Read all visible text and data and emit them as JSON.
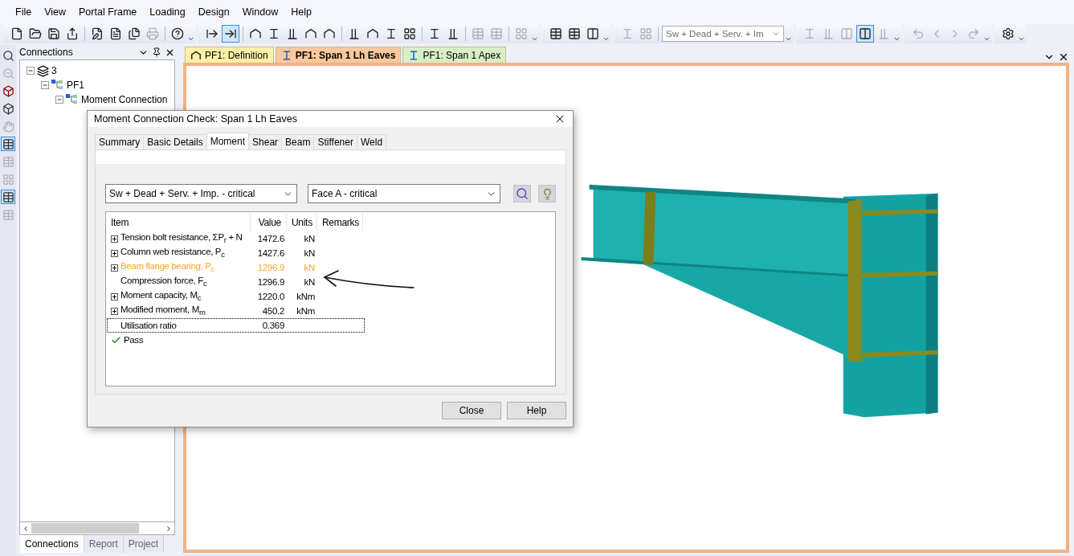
{
  "menu": [
    "File",
    "View",
    "Portal Frame",
    "Loading",
    "Design",
    "Window",
    "Help"
  ],
  "toolbar": [
    {
      "items": [
        {
          "kind": "button",
          "pressed": false,
          "disabled": false
        },
        {
          "kind": "button",
          "pressed": false,
          "disabled": false
        },
        {
          "kind": "button",
          "pressed": false,
          "disabled": false
        },
        {
          "kind": "button",
          "pressed": false,
          "disabled": false
        },
        {
          "kind": "separator"
        },
        {
          "kind": "button",
          "pressed": false,
          "disabled": false
        },
        {
          "kind": "button",
          "pressed": false,
          "disabled": false
        },
        {
          "kind": "button",
          "pressed": false,
          "disabled": false
        },
        {
          "kind": "button",
          "pressed": false,
          "disabled": true
        },
        {
          "kind": "separator"
        },
        {
          "kind": "button",
          "pressed": false,
          "disabled": false
        }
      ]
    },
    {
      "items": [
        {
          "kind": "button",
          "pressed": false,
          "disabled": false
        },
        {
          "kind": "button",
          "pressed": true,
          "disabled": false
        },
        {
          "kind": "separator"
        },
        {
          "kind": "button",
          "pressed": false,
          "disabled": false
        },
        {
          "kind": "button",
          "pressed": false,
          "disabled": false
        },
        {
          "kind": "button",
          "pressed": false,
          "disabled": false
        },
        {
          "kind": "button",
          "pressed": false,
          "disabled": false
        },
        {
          "kind": "button",
          "pressed": false,
          "disabled": false
        },
        {
          "kind": "separator"
        },
        {
          "kind": "button",
          "pressed": false,
          "disabled": false
        },
        {
          "kind": "button",
          "pressed": false,
          "disabled": false
        },
        {
          "kind": "button",
          "pressed": false,
          "disabled": false
        },
        {
          "kind": "button",
          "pressed": false,
          "disabled": false
        },
        {
          "kind": "separator"
        },
        {
          "kind": "button",
          "pressed": false,
          "disabled": false
        },
        {
          "kind": "button",
          "pressed": false,
          "disabled": false
        },
        {
          "kind": "separator"
        },
        {
          "kind": "button",
          "pressed": false,
          "disabled": true
        },
        {
          "kind": "button",
          "pressed": false,
          "disabled": true
        },
        {
          "kind": "separator"
        },
        {
          "kind": "button",
          "pressed": false,
          "disabled": true
        }
      ]
    },
    {
      "items": [
        {
          "kind": "button",
          "pressed": false,
          "disabled": false
        },
        {
          "kind": "button",
          "pressed": false,
          "disabled": false
        },
        {
          "kind": "button",
          "pressed": false,
          "disabled": false
        }
      ]
    },
    {
      "items": [
        {
          "kind": "button",
          "pressed": false,
          "disabled": true
        },
        {
          "kind": "button",
          "pressed": false,
          "disabled": true
        },
        {
          "kind": "separator"
        },
        {
          "kind": "combo",
          "value": "Sw + Dead + Serv. + Im"
        }
      ]
    },
    {
      "items": [
        {
          "kind": "button",
          "pressed": false,
          "disabled": true
        },
        {
          "kind": "button",
          "pressed": false,
          "disabled": true
        },
        {
          "kind": "button",
          "pressed": false,
          "disabled": true
        },
        {
          "kind": "button",
          "pressed": true,
          "disabled": false
        },
        {
          "kind": "button",
          "pressed": false,
          "disabled": true
        }
      ]
    },
    {
      "items": [
        {
          "kind": "button",
          "pressed": false,
          "disabled": true
        },
        {
          "kind": "button",
          "pressed": false,
          "disabled": true
        },
        {
          "kind": "button",
          "pressed": false,
          "disabled": true
        },
        {
          "kind": "button",
          "pressed": false,
          "disabled": true
        }
      ]
    },
    {
      "items": [
        {
          "kind": "button",
          "pressed": false,
          "disabled": false
        }
      ]
    }
  ],
  "side_tools": [
    {
      "pressed": false,
      "disabled": false
    },
    {
      "pressed": false,
      "disabled": true
    },
    {
      "pressed": false,
      "disabled": false
    },
    {
      "pressed": false,
      "disabled": false
    },
    {
      "pressed": false,
      "disabled": true
    },
    {
      "pressed": true,
      "disabled": false
    },
    {
      "pressed": false,
      "disabled": true
    },
    {
      "pressed": false,
      "disabled": true
    },
    {
      "pressed": true,
      "disabled": false
    },
    {
      "pressed": false,
      "disabled": true
    }
  ],
  "connections_panel": {
    "title": "Connections",
    "tree": [
      {
        "label": "3",
        "expanded": true,
        "children": [
          {
            "label": "PF1",
            "expanded": true,
            "children": [
              {
                "label": "Moment Connection",
                "expanded": true
              }
            ]
          }
        ]
      }
    ],
    "tabs": [
      {
        "label": "Connections",
        "selected": true
      },
      {
        "label": "Report",
        "selected": false
      },
      {
        "label": "Project",
        "selected": false
      }
    ]
  },
  "document_tabs": [
    {
      "label": "PF1: Definition",
      "selected": false,
      "color": "#fdf0a6"
    },
    {
      "label": "PF1: Span 1 Lh Eaves",
      "selected": true,
      "color": "#f9c89c"
    },
    {
      "label": "PF1: Span 1 Apex",
      "selected": false,
      "color": "#d8efc6"
    }
  ],
  "dialog": {
    "title": "Moment Connection Check: Span 1 Lh Eaves",
    "tabs": [
      {
        "label": "Summary",
        "selected": false
      },
      {
        "label": "Basic Details",
        "selected": false
      },
      {
        "label": "Moment",
        "selected": true
      },
      {
        "label": "Shear",
        "selected": false
      },
      {
        "label": "Beam",
        "selected": false
      },
      {
        "label": "Stiffener",
        "selected": false
      },
      {
        "label": "Weld",
        "selected": false
      }
    ],
    "load_case": "Sw + Dead + Serv. + Imp. - critical",
    "face": "Face A - critical",
    "columns": [
      "Item",
      "Value",
      "Units",
      "Remarks"
    ],
    "rows": [
      {
        "kind": "value",
        "item": "Tension bolt resistance, ΣP$_{r}$ + N",
        "value": "1472.6",
        "units": "kN",
        "expandable": true,
        "highlighted": false,
        "selected": false
      },
      {
        "kind": "value",
        "item": "Column web resistance, P$_{c}$",
        "value": "1427.6",
        "units": "kN",
        "expandable": true,
        "highlighted": false,
        "selected": false
      },
      {
        "kind": "value",
        "item": "Beam flange bearing, P$_{c}$",
        "value": "1296.9",
        "units": "kN",
        "expandable": true,
        "highlighted": true,
        "selected": false
      },
      {
        "kind": "value",
        "item": "Compression force, F$_{c}$",
        "value": "1296.9",
        "units": "kN",
        "expandable": false,
        "highlighted": false,
        "selected": false
      },
      {
        "kind": "value",
        "item": "Moment capacity, M$_{c}$",
        "value": "1220.0",
        "units": "kNm",
        "expandable": true,
        "highlighted": false,
        "selected": false
      },
      {
        "kind": "value",
        "item": "Modified moment, M$_{m}$",
        "value": "450.2",
        "units": "kNm",
        "expandable": true,
        "highlighted": false,
        "selected": false
      },
      {
        "kind": "value",
        "item": "Utilisation ratio",
        "value": "0.369",
        "expandable": false,
        "highlighted": false,
        "selected": true
      },
      {
        "kind": "result",
        "item": "Pass",
        "expandable": false,
        "highlighted": false,
        "selected": false
      }
    ],
    "buttons": [
      "Close",
      "Help"
    ]
  }
}
